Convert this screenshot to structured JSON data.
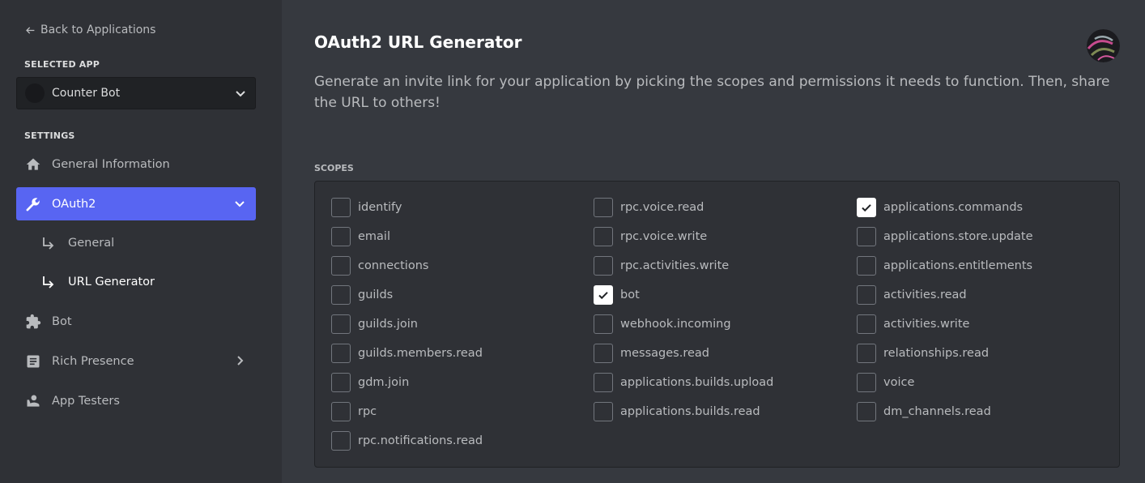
{
  "sidebar": {
    "back_label": "Back to Applications",
    "selected_app_heading": "SELECTED APP",
    "selected_app": "Counter Bot",
    "settings_heading": "SETTINGS",
    "items": [
      {
        "label": "General Information",
        "icon": "home-icon"
      },
      {
        "label": "OAuth2",
        "icon": "wrench-icon",
        "active": true
      },
      {
        "label": "Bot",
        "icon": "puzzle-icon"
      },
      {
        "label": "Rich Presence",
        "icon": "document-icon"
      },
      {
        "label": "App Testers",
        "icon": "user-tester-icon"
      }
    ],
    "subitems": [
      {
        "label": "General"
      },
      {
        "label": "URL Generator",
        "current": true
      }
    ]
  },
  "main": {
    "title": "OAuth2 URL Generator",
    "description": "Generate an invite link for your application by picking the scopes and permissions it needs to function. Then, share the URL to others!",
    "scopes_heading": "SCOPES",
    "scopes": [
      {
        "label": "identify",
        "checked": false
      },
      {
        "label": "email",
        "checked": false
      },
      {
        "label": "connections",
        "checked": false
      },
      {
        "label": "guilds",
        "checked": false
      },
      {
        "label": "guilds.join",
        "checked": false
      },
      {
        "label": "guilds.members.read",
        "checked": false
      },
      {
        "label": "gdm.join",
        "checked": false
      },
      {
        "label": "rpc",
        "checked": false
      },
      {
        "label": "rpc.notifications.read",
        "checked": false
      },
      {
        "label": "rpc.voice.read",
        "checked": false
      },
      {
        "label": "rpc.voice.write",
        "checked": false
      },
      {
        "label": "rpc.activities.write",
        "checked": false
      },
      {
        "label": "bot",
        "checked": true
      },
      {
        "label": "webhook.incoming",
        "checked": false
      },
      {
        "label": "messages.read",
        "checked": false
      },
      {
        "label": "applications.builds.upload",
        "checked": false
      },
      {
        "label": "applications.builds.read",
        "checked": false
      },
      {
        "label": "applications.commands",
        "checked": true
      },
      {
        "label": "applications.store.update",
        "checked": false
      },
      {
        "label": "applications.entitlements",
        "checked": false
      },
      {
        "label": "activities.read",
        "checked": false
      },
      {
        "label": "activities.write",
        "checked": false
      },
      {
        "label": "relationships.read",
        "checked": false
      },
      {
        "label": "voice",
        "checked": false
      },
      {
        "label": "dm_channels.read",
        "checked": false
      }
    ]
  },
  "colors": {
    "accent": "#5865f2",
    "sidebar_bg": "#2f3136",
    "main_bg": "#36393f"
  }
}
